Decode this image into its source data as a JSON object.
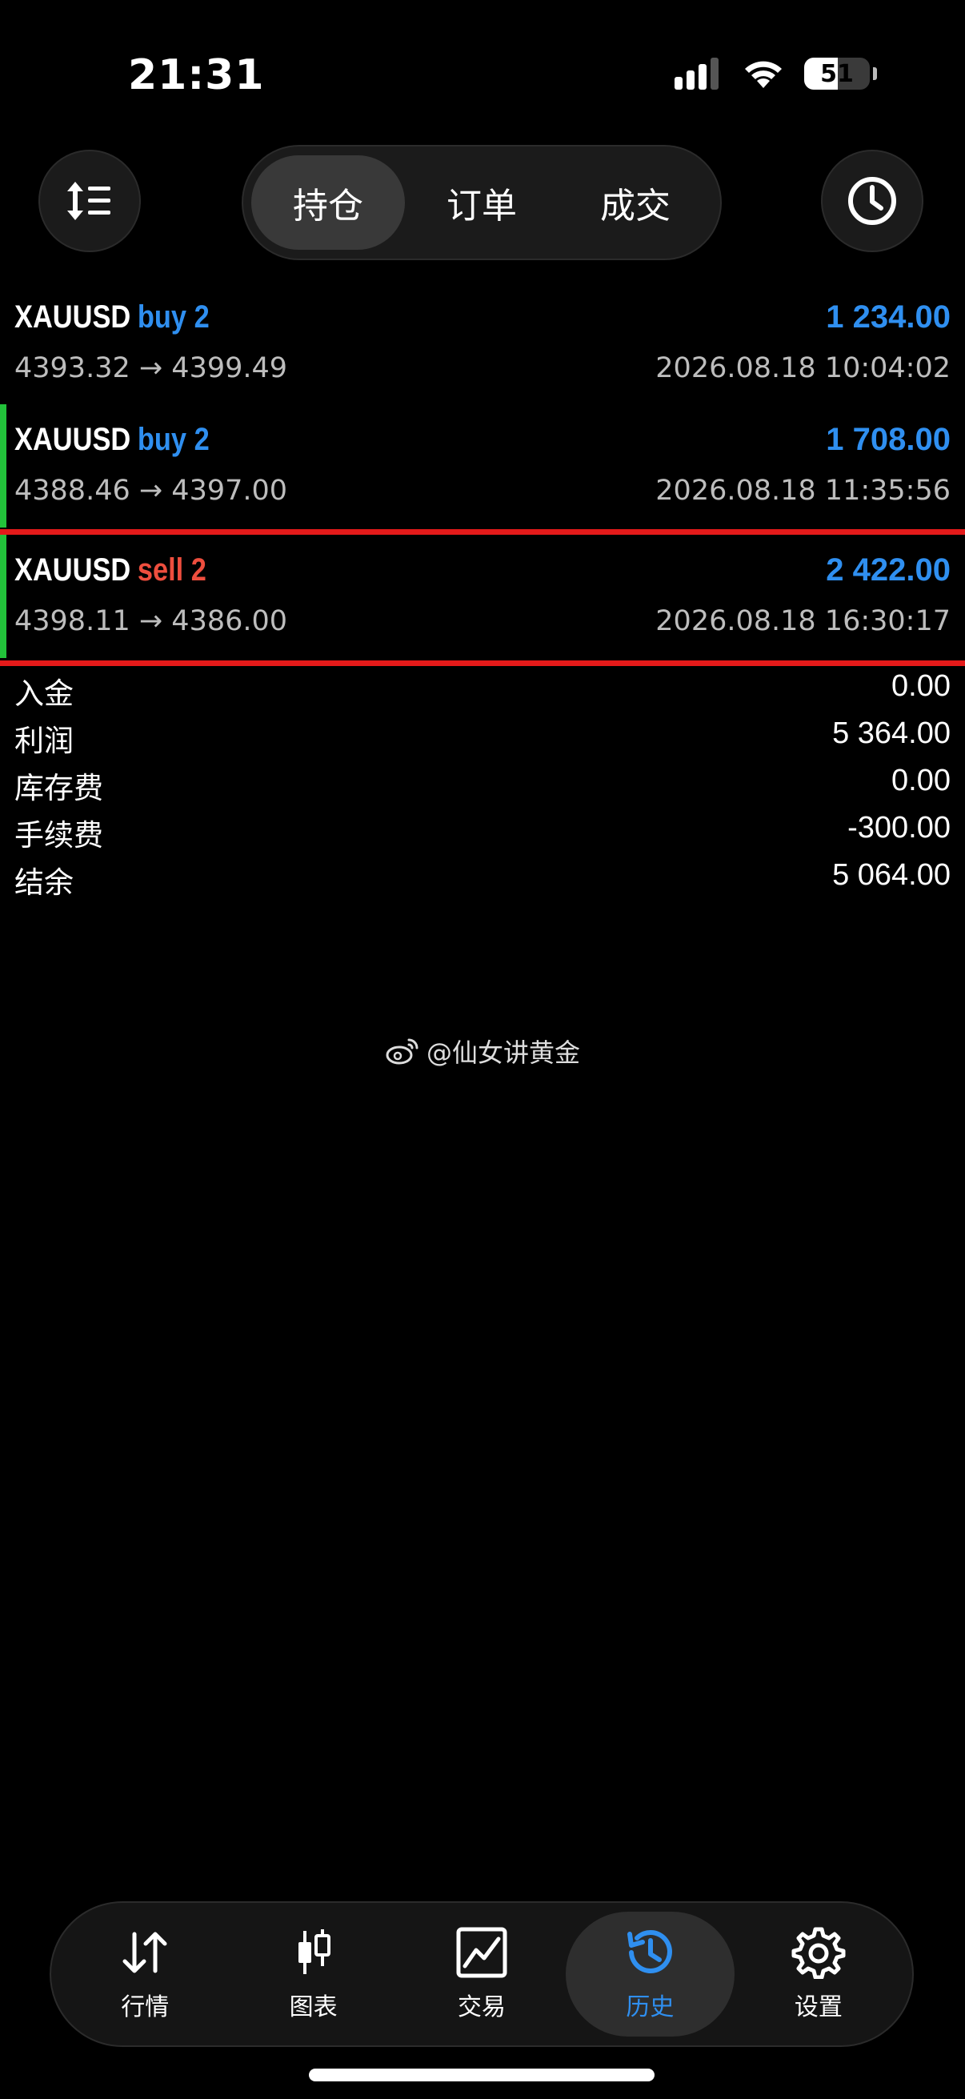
{
  "status_bar": {
    "time": "21:31",
    "battery": "51",
    "battery_level": 0.51
  },
  "top_tabs": [
    {
      "label": "持仓",
      "active": true
    },
    {
      "label": "订单",
      "active": false
    },
    {
      "label": "成交",
      "active": false
    }
  ],
  "trades": [
    {
      "symbol": "XAUUSD",
      "side": "buy 2",
      "direction": "buy",
      "profit": "1 234.00",
      "prices": "4393.32 → 4399.49",
      "time": "2026.08.18 10:04:02",
      "marked": false
    },
    {
      "symbol": "XAUUSD",
      "side": "buy 2",
      "direction": "buy",
      "profit": "1 708.00",
      "prices": "4388.46 → 4397.00",
      "time": "2026.08.18 11:35:56",
      "marked": true
    },
    {
      "symbol": "XAUUSD",
      "side": "sell 2",
      "direction": "sell",
      "profit": "2 422.00",
      "prices": "4398.11 → 4386.00",
      "time": "2026.08.18 16:30:17",
      "marked": true
    }
  ],
  "summary": [
    {
      "label": "入金",
      "value": "0.00"
    },
    {
      "label": "利润",
      "value": "5 364.00"
    },
    {
      "label": "库存费",
      "value": "0.00"
    },
    {
      "label": "手续费",
      "value": "-300.00"
    },
    {
      "label": "结余",
      "value": "5 064.00"
    }
  ],
  "watermark": "@仙女讲黄金",
  "bottom_tabs": [
    {
      "label": "行情",
      "icon": "arrows-up-down-icon",
      "active": false
    },
    {
      "label": "图表",
      "icon": "candlestick-icon",
      "active": false
    },
    {
      "label": "交易",
      "icon": "trade-chart-icon",
      "active": false
    },
    {
      "label": "历史",
      "icon": "history-icon",
      "active": true
    },
    {
      "label": "设置",
      "icon": "gear-icon",
      "active": false
    }
  ],
  "colors": {
    "buy": "#2f8ff0",
    "sell": "#ee4e3e",
    "marker": "#22c23a",
    "highlight_line": "#e41a1a",
    "active_tab": "#2f8ff0"
  }
}
